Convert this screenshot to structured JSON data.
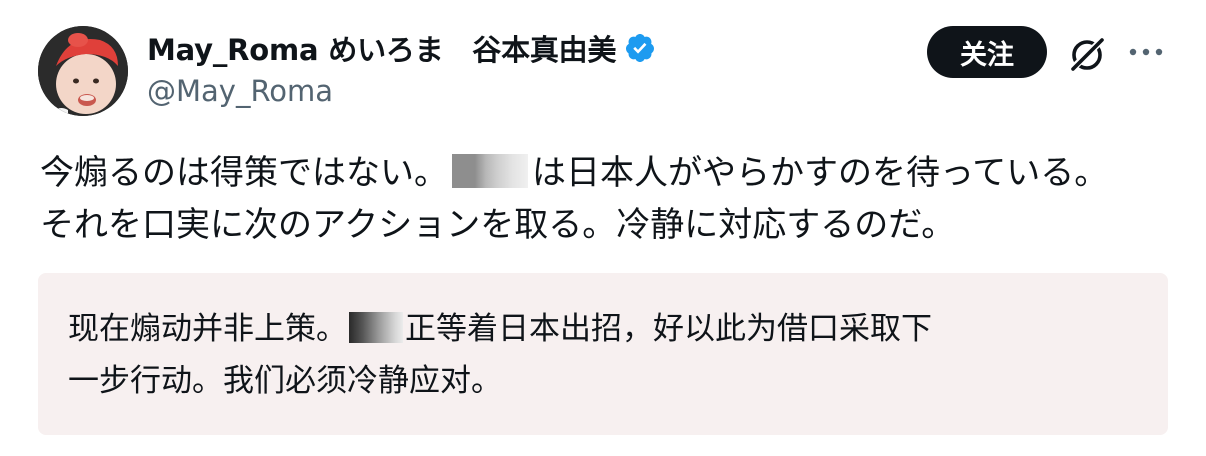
{
  "author": {
    "display_name": "May_Roma めいろま　谷本真由美",
    "handle": "@May_Roma",
    "verified": true,
    "avatar_icon": "baby-portrait-avatar"
  },
  "actions": {
    "follow_label": "关注",
    "grok_icon": "grok-slash-circle-icon",
    "more_icon": "ellipsis-icon"
  },
  "tweet": {
    "text_part1": "今煽るのは得策ではない。",
    "text_part2": "は日本人がやらかすのを待っている。\nそれを口実に次のアクションを取る。冷静に対応するのだ。"
  },
  "translation": {
    "text_part1": "现在煽动并非上策。",
    "text_part2": "正等着日本出招，好以此为借口采取下\n一步行动。我们必须冷静应对。"
  },
  "colors": {
    "text_primary": "#0f1419",
    "text_secondary": "#536471",
    "verified_blue": "#1d9bf0",
    "translation_bg": "#f7f0f0",
    "button_bg": "#0f1419"
  }
}
